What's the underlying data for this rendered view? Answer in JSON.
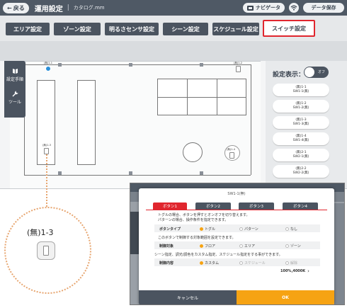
{
  "header": {
    "back_label": "戻る",
    "title": "運用設定",
    "file_name": "カタログ.mm",
    "navigator_label": "ナビゲータ",
    "save_label": "データ保存"
  },
  "tabs": [
    {
      "label": "エリア設定"
    },
    {
      "label": "ゾーン設定"
    },
    {
      "label": "明るさセンサ設定"
    },
    {
      "label": "シーン設定"
    },
    {
      "label": "スケジュール設定"
    },
    {
      "label": "スイッチ設定"
    }
  ],
  "side_tools": {
    "steps_label": "設定手順",
    "tool_label": "ツール"
  },
  "right_panel": {
    "display_label": "設定表示：",
    "toggle_state": "オフ",
    "switches": [
      {
        "name": "(無)1-1",
        "sub": "SW1-1(無)"
      },
      {
        "name": "(無)1-2",
        "sub": "SW1-2(無)"
      },
      {
        "name": "(無)1-3",
        "sub": "SW1-3(無)"
      },
      {
        "name": "(無)1-4",
        "sub": "SW1-4(無)"
      },
      {
        "name": "(無)2-1",
        "sub": "SW2-1(無)"
      },
      {
        "name": "(無)2-2",
        "sub": "SW2-2(無)"
      }
    ]
  },
  "map_labels": {
    "sw_1_1": "(無)1-1",
    "sw_1_2": "(無)1-2",
    "sw_1_3": "(無)1-3",
    "sw_1_4": "(無)1-4"
  },
  "callout": {
    "label": "(無)1-3"
  },
  "modal": {
    "title": "SW1-1(無)",
    "tabs": [
      "ボタン1",
      "ボタン2",
      "ボタン3",
      "ボタン4"
    ],
    "desc1": "トグルの場合、ボタンを押すとオンオフを切り替えます。",
    "desc2": "パターンの場合、操作条件を指定できます。",
    "button_type_label": "ボタンタイプ",
    "button_type_options": [
      "トグル",
      "パターン",
      "なし"
    ],
    "target_desc": "このボタンで制御する対象範囲を設定できます。",
    "target_label": "制御対象",
    "target_options": [
      "フロア",
      "エリア",
      "ゾーン"
    ],
    "content_desc": "シーン指定、調光/調色をカスタム指定、スケジュール指定をする事ができます。",
    "content_label": "制御内容",
    "content_options": [
      "カスタム",
      "スケジュール",
      "解除"
    ],
    "color_value": "100%,4000K",
    "cancel_label": "キャンセル",
    "ok_label": "OK"
  }
}
